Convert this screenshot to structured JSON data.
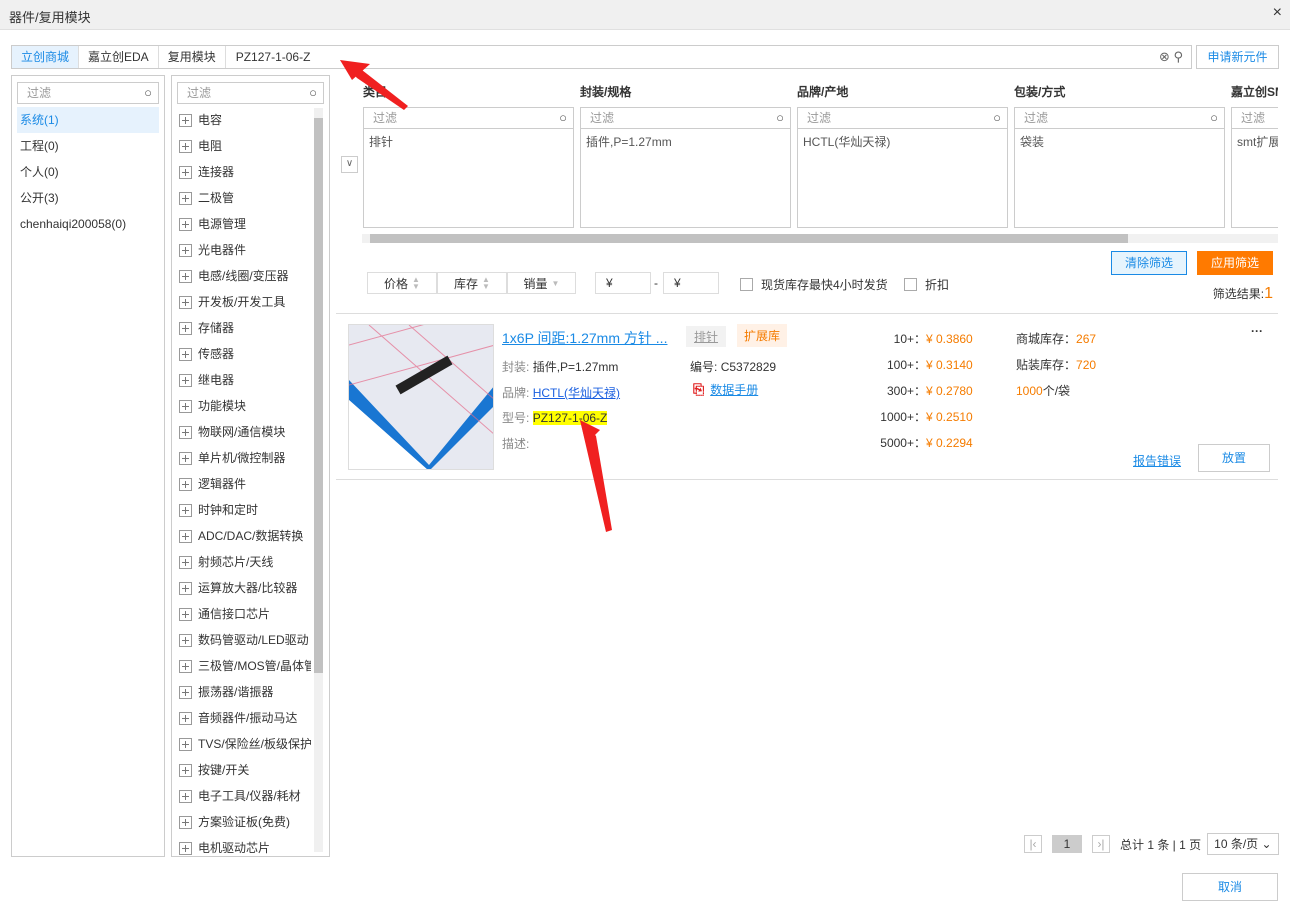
{
  "window": {
    "title": "器件/复用模块",
    "close": "×"
  },
  "tabs": [
    {
      "label": "立创商城"
    },
    {
      "label": "嘉立创EDA"
    },
    {
      "label": "复用模块"
    }
  ],
  "search": {
    "value": "PZ127-1-06-Z",
    "new_part": "申请新元件"
  },
  "filter_placeholder": "过滤",
  "libraries": [
    {
      "label": "系统(1)"
    },
    {
      "label": "工程(0)"
    },
    {
      "label": "个人(0)"
    },
    {
      "label": "公开(3)"
    },
    {
      "label": "chenhaiqi200058(0)"
    }
  ],
  "categories": [
    "电容",
    "电阻",
    "连接器",
    "二极管",
    "电源管理",
    "光电器件",
    "电感/线圈/变压器",
    "开发板/开发工具",
    "存储器",
    "传感器",
    "继电器",
    "功能模块",
    "物联网/通信模块",
    "单片机/微控制器",
    "逻辑器件",
    "时钟和定时",
    "ADC/DAC/数据转换",
    "射频芯片/天线",
    "运算放大器/比较器",
    "通信接口芯片",
    "数码管驱动/LED驱动",
    "三极管/MOS管/晶体管",
    "振荡器/谐振器",
    "音频器件/振动马达",
    "TVS/保险丝/板级保护",
    "按键/开关",
    "电子工具/仪器/耗材",
    "方案验证板(免费)",
    "电机驱动芯片"
  ],
  "facets": [
    {
      "title": "类目",
      "value": "排针"
    },
    {
      "title": "封装/规格",
      "value": "插件,P=1.27mm"
    },
    {
      "title": "品牌/产地",
      "value": "HCTL(华灿天禄)"
    },
    {
      "title": "包装/方式",
      "value": "袋装"
    },
    {
      "title": "嘉立创SMT",
      "value": "smt扩展"
    }
  ],
  "sort": {
    "price": "价格",
    "stock": "库存",
    "sales": "销量",
    "currency": "¥",
    "dash": "-",
    "fast_ship": "现货库存最快4小时发货",
    "discount": "折扣"
  },
  "buttons": {
    "clear": "清除筛选",
    "apply": "应用筛选",
    "place": "放置",
    "report": "报告错误",
    "cancel": "取消"
  },
  "result": {
    "label": "筛选结果:",
    "count": "1"
  },
  "product": {
    "title": "1x6P 间距:1.27mm 方针 ...",
    "tag_category": "排针",
    "tag_lib": "扩展库",
    "package_label": "封装:",
    "package": "插件,P=1.27mm",
    "code_label": "编号:",
    "code": "C5372829",
    "brand_label": "品牌:",
    "brand": "HCTL(华灿天禄)",
    "datasheet": "数据手册",
    "model_label": "型号:",
    "model": "PZ127-1-06-Z",
    "desc_label": "描述:",
    "prices": [
      {
        "qty": "10+：",
        "price": "¥ 0.3860"
      },
      {
        "qty": "100+：",
        "price": "¥ 0.3140"
      },
      {
        "qty": "300+：",
        "price": "¥ 0.2780"
      },
      {
        "qty": "1000+：",
        "price": "¥ 0.2510"
      },
      {
        "qty": "5000+：",
        "price": "¥ 0.2294"
      }
    ],
    "mall_stock_label": "商城库存：",
    "mall_stock": "267",
    "smt_stock_label": "贴装库存：",
    "smt_stock": "720",
    "pack_qty": "1000",
    "pack_unit": "个/袋",
    "more": "···"
  },
  "pagination": {
    "page": "1",
    "summary": "总计 1 条 | 1 页",
    "per_page": "10 条/页"
  }
}
